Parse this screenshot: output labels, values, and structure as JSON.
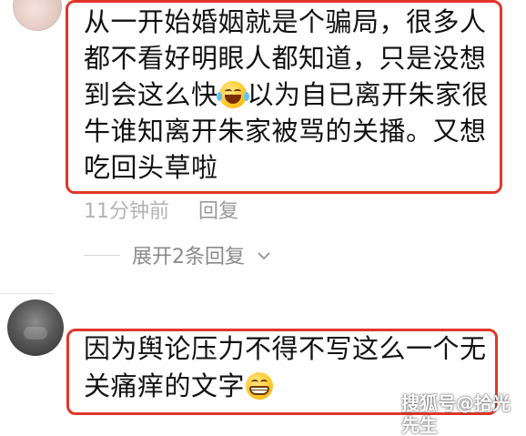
{
  "comment1": {
    "text_before_emoji": "从一开始婚姻就是个骗局，很多人都不看好明眼人都知道，只是没想到会这么快",
    "text_after_emoji": "以为自已离开朱家很牛谁知离开朱家被骂的关播。又想吃回头草啦",
    "emoji": "tears-of-joy-emoji",
    "time": "11分钟前",
    "reply_label": "回复"
  },
  "expand": {
    "label": "展开2条回复"
  },
  "comment2": {
    "text": "因为舆论压力不得不写这么一个无关痛痒的文字",
    "emoji": "grinning-emoji"
  },
  "watermark": {
    "text": "搜狐号@拾光先生"
  },
  "colors": {
    "highlight_border": "#e2362a",
    "meta_text": "#b3b3b3",
    "body_text": "#111111"
  }
}
